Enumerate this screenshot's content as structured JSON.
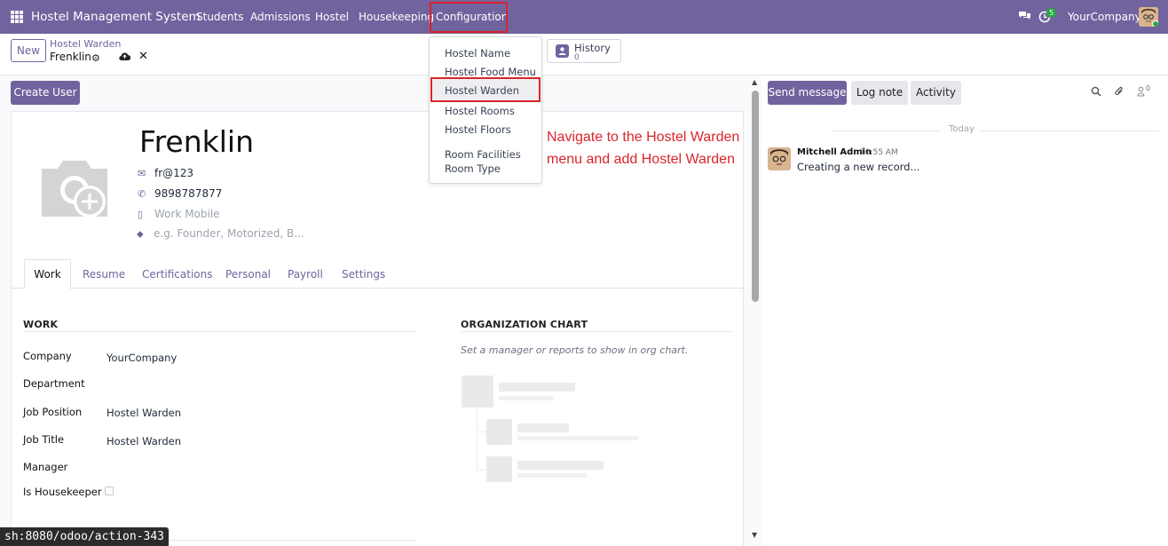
{
  "app": {
    "title": "Hostel Management System"
  },
  "nav": {
    "items": [
      {
        "label": "Students"
      },
      {
        "label": "Admissions"
      },
      {
        "label": "Hostel"
      },
      {
        "label": "Housekeeping"
      },
      {
        "label": "Configuration"
      }
    ],
    "activity_count": "5",
    "company": "YourCompany"
  },
  "toolbar": {
    "new_label": "New",
    "breadcrumb_parent": "Hostel Warden",
    "breadcrumb_current": "Frenklin",
    "history_label": "History",
    "history_count": "0"
  },
  "config_menu": {
    "items": [
      {
        "label": "Hostel Name"
      },
      {
        "label": "Hostel Food Menu"
      },
      {
        "label": "Hostel Warden"
      },
      {
        "label": "Hostel Rooms"
      },
      {
        "label": "Hostel Floors"
      },
      {
        "label": "Room Facilities"
      },
      {
        "label": "Room Type"
      }
    ],
    "highlighted": "Hostel Warden"
  },
  "annotation": {
    "line1": "Navigate to the Hostel Warden",
    "line2": "menu and add Hostel Warden"
  },
  "form": {
    "create_user_label": "Create User",
    "name": "Frenklin",
    "email": "fr@123",
    "phone": "9898787877",
    "mobile_placeholder": "Work Mobile",
    "tags_placeholder": "e.g. Founder, Motorized, B..."
  },
  "tabs": [
    {
      "label": "Work"
    },
    {
      "label": "Resume"
    },
    {
      "label": "Certifications"
    },
    {
      "label": "Personal"
    },
    {
      "label": "Payroll"
    },
    {
      "label": "Settings"
    }
  ],
  "work": {
    "section_title": "WORK",
    "fields": [
      {
        "label": "Company",
        "value": "YourCompany"
      },
      {
        "label": "Department",
        "value": ""
      },
      {
        "label": "Job Position",
        "value": "Hostel Warden"
      },
      {
        "label": "Job Title",
        "value": "Hostel Warden"
      },
      {
        "label": "Manager",
        "value": ""
      },
      {
        "label": "Is Housekeeper",
        "value": ""
      }
    ],
    "is_housekeeper": false
  },
  "org": {
    "section_title": "ORGANIZATION CHART",
    "hint": "Set a manager or reports to show in org chart."
  },
  "chatter": {
    "send_message": "Send message",
    "log_note": "Log note",
    "activity": "Activity",
    "followers_count": "0",
    "today_label": "Today",
    "message": {
      "author": "Mitchell Admin",
      "time": "10:55 AM",
      "body": "Creating a new record..."
    }
  },
  "status_url": "sh:8080/odoo/action-343",
  "colors": {
    "brand": "#71639e",
    "highlight": "#d9252b"
  },
  "icons": [
    "apps-grid-icon",
    "chat-icon",
    "clock-icon",
    "gear-icon",
    "cloud-save-icon",
    "close-icon",
    "history-icon",
    "camera-plus-icon",
    "envelope-icon",
    "phone-icon",
    "mobile-icon",
    "tags-icon",
    "search-icon",
    "paperclip-icon",
    "follower-icon"
  ]
}
